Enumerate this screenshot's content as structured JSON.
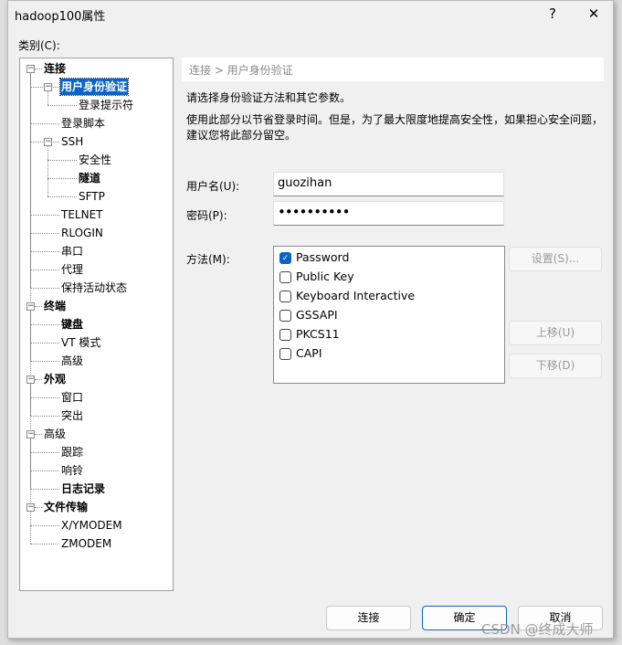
{
  "window": {
    "title": "hadoop100属性",
    "help_label": "?",
    "close_label": "✕"
  },
  "category_label": "类别(C):",
  "tree": [
    {
      "label": "连接",
      "level": 0,
      "bold": true,
      "expander": true
    },
    {
      "label": "用户身份验证",
      "level": 1,
      "bold": true,
      "expander": true,
      "selected": true
    },
    {
      "label": "登录提示符",
      "level": 2
    },
    {
      "label": "登录脚本",
      "level": 1
    },
    {
      "label": "SSH",
      "level": 1,
      "expander": true
    },
    {
      "label": "安全性",
      "level": 2
    },
    {
      "label": "隧道",
      "level": 2,
      "bold": true
    },
    {
      "label": "SFTP",
      "level": 2
    },
    {
      "label": "TELNET",
      "level": 1
    },
    {
      "label": "RLOGIN",
      "level": 1
    },
    {
      "label": "串口",
      "level": 1
    },
    {
      "label": "代理",
      "level": 1
    },
    {
      "label": "保持活动状态",
      "level": 1
    },
    {
      "label": "终端",
      "level": 0,
      "bold": true,
      "expander": true
    },
    {
      "label": "键盘",
      "level": 1,
      "bold": true
    },
    {
      "label": "VT 模式",
      "level": 1
    },
    {
      "label": "高级",
      "level": 1
    },
    {
      "label": "外观",
      "level": 0,
      "bold": true,
      "expander": true
    },
    {
      "label": "窗口",
      "level": 1
    },
    {
      "label": "突出",
      "level": 1
    },
    {
      "label": "高级",
      "level": 0,
      "expander": true
    },
    {
      "label": "跟踪",
      "level": 1
    },
    {
      "label": "响铃",
      "level": 1
    },
    {
      "label": "日志记录",
      "level": 1,
      "bold": true
    },
    {
      "label": "文件传输",
      "level": 0,
      "bold": true,
      "expander": true
    },
    {
      "label": "X/YMODEM",
      "level": 1
    },
    {
      "label": "ZMODEM",
      "level": 1
    }
  ],
  "breadcrumb": "连接 > 用户身份验证",
  "intro": "请选择身份验证方法和其它参数。",
  "note_line1": "使用此部分以节省登录时间。但是，为了最大限度地提高安全性，如果担心安全问题，",
  "note_line2": "建议您将此部分留空。",
  "username": {
    "label": "用户名(U):",
    "value": "guozihan"
  },
  "password": {
    "label": "密码(P):",
    "value": "••••••••••"
  },
  "method_label": "方法(M):",
  "methods": [
    {
      "label": "Password",
      "checked": true
    },
    {
      "label": "Public Key",
      "checked": false
    },
    {
      "label": "Keyboard Interactive",
      "checked": false
    },
    {
      "label": "GSSAPI",
      "checked": false
    },
    {
      "label": "PKCS11",
      "checked": false
    },
    {
      "label": "CAPI",
      "checked": false
    }
  ],
  "side_buttons": {
    "settings": "设置(S)...",
    "up": "上移(U)",
    "down": "下移(D)"
  },
  "buttons": {
    "connect": "连接",
    "ok": "确定",
    "cancel": "取消"
  },
  "watermark": "CSDN @终成大师",
  "colors": {
    "accent": "#0a64c8"
  }
}
